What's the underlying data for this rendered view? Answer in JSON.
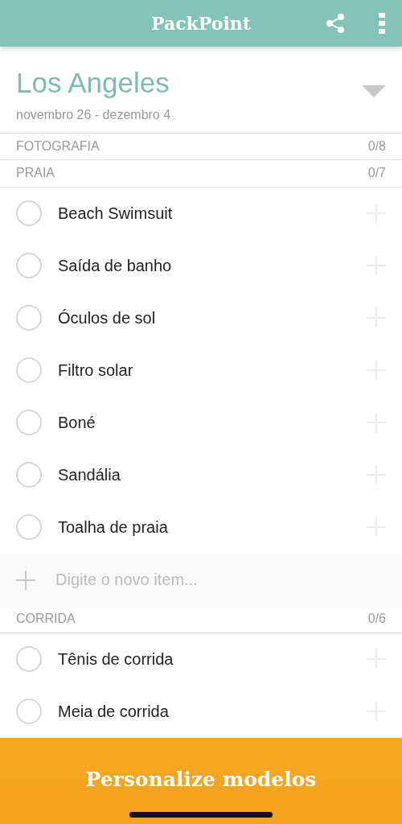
{
  "app_bar": {
    "title": "PackPoint"
  },
  "trip": {
    "city": "Los Angeles",
    "dates": "novembro 26 - dezembro 4"
  },
  "sections": [
    {
      "name": "FOTOGRAFIA",
      "count": "0/8"
    },
    {
      "name": "PRAIA",
      "count": "0/7",
      "new_item_placeholder": "Digite o novo item...",
      "items": [
        {
          "label": "Beach Swimsuit",
          "checked": false
        },
        {
          "label": "Saída de banho",
          "checked": false
        },
        {
          "label": "Óculos de sol",
          "checked": false
        },
        {
          "label": "Filtro solar",
          "checked": false
        },
        {
          "label": "Boné",
          "checked": false
        },
        {
          "label": "Sandália",
          "checked": false
        },
        {
          "label": "Toalha de praia",
          "checked": false
        }
      ]
    },
    {
      "name": "CORRIDA",
      "count": "0/6",
      "items": [
        {
          "label": "Tênis de corrida",
          "checked": false
        },
        {
          "label": "Meia de corrida",
          "checked": false
        }
      ]
    }
  ],
  "footer_button": {
    "label": "Personalize modelos"
  }
}
